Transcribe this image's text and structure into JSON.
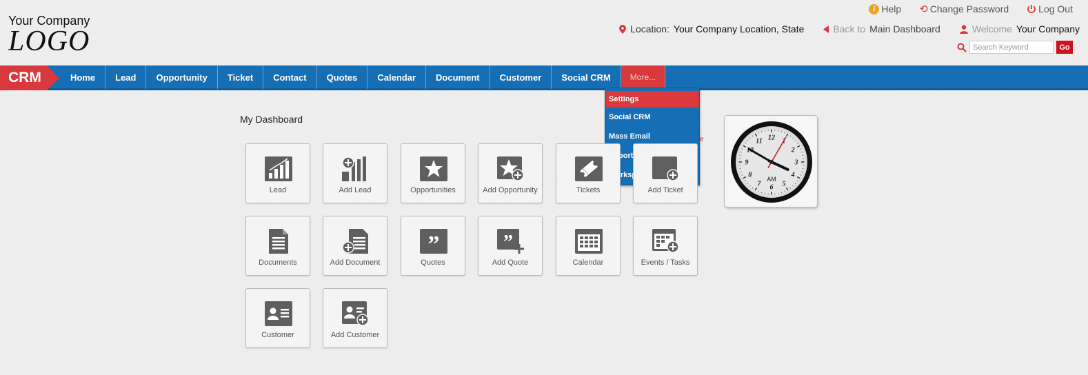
{
  "header": {
    "company": "Your Company",
    "logo": "LOGO",
    "links": {
      "help": "Help",
      "change_password": "Change Password",
      "logout": "Log Out"
    },
    "location_label": "Location:",
    "location_value": "Your Company Location, State",
    "back_muted": "Back to",
    "back_link": "Main Dashboard",
    "welcome_label": "Welcome",
    "welcome_value": "Your Company",
    "search_placeholder": "Search Keyword",
    "go_label": "Go"
  },
  "nav": {
    "badge": "CRM",
    "items": [
      "Home",
      "Lead",
      "Opportunity",
      "Ticket",
      "Contact",
      "Quotes",
      "Calendar",
      "Document",
      "Customer",
      "Social CRM"
    ],
    "more_label": "More..."
  },
  "dropdown": {
    "items": [
      "Settings",
      "Social CRM",
      "Mass Email",
      "Report",
      "Workspace"
    ]
  },
  "dashboard": {
    "title": "My Dashboard",
    "stray_char": "e",
    "tiles": [
      "Lead",
      "Add Lead",
      "Opportunities",
      "Add Opportunity",
      "Tickets",
      "Add Ticket",
      "Documents",
      "Add Document",
      "Quotes",
      "Add Quote",
      "Calendar",
      "Events / Tasks",
      "Customer",
      "Add Customer"
    ]
  },
  "clock": {
    "numerals": [
      "12",
      "1",
      "2",
      "3",
      "4",
      "5",
      "6",
      "7",
      "8",
      "9",
      "10",
      "11"
    ],
    "ampm": "AM",
    "hour": 3,
    "minute": 50,
    "second": 5
  },
  "colors": {
    "nav_blue": "#166fb4",
    "accent_red": "#d7393d",
    "help_orange": "#f2a223",
    "icon_gray": "#5f5f5f"
  }
}
